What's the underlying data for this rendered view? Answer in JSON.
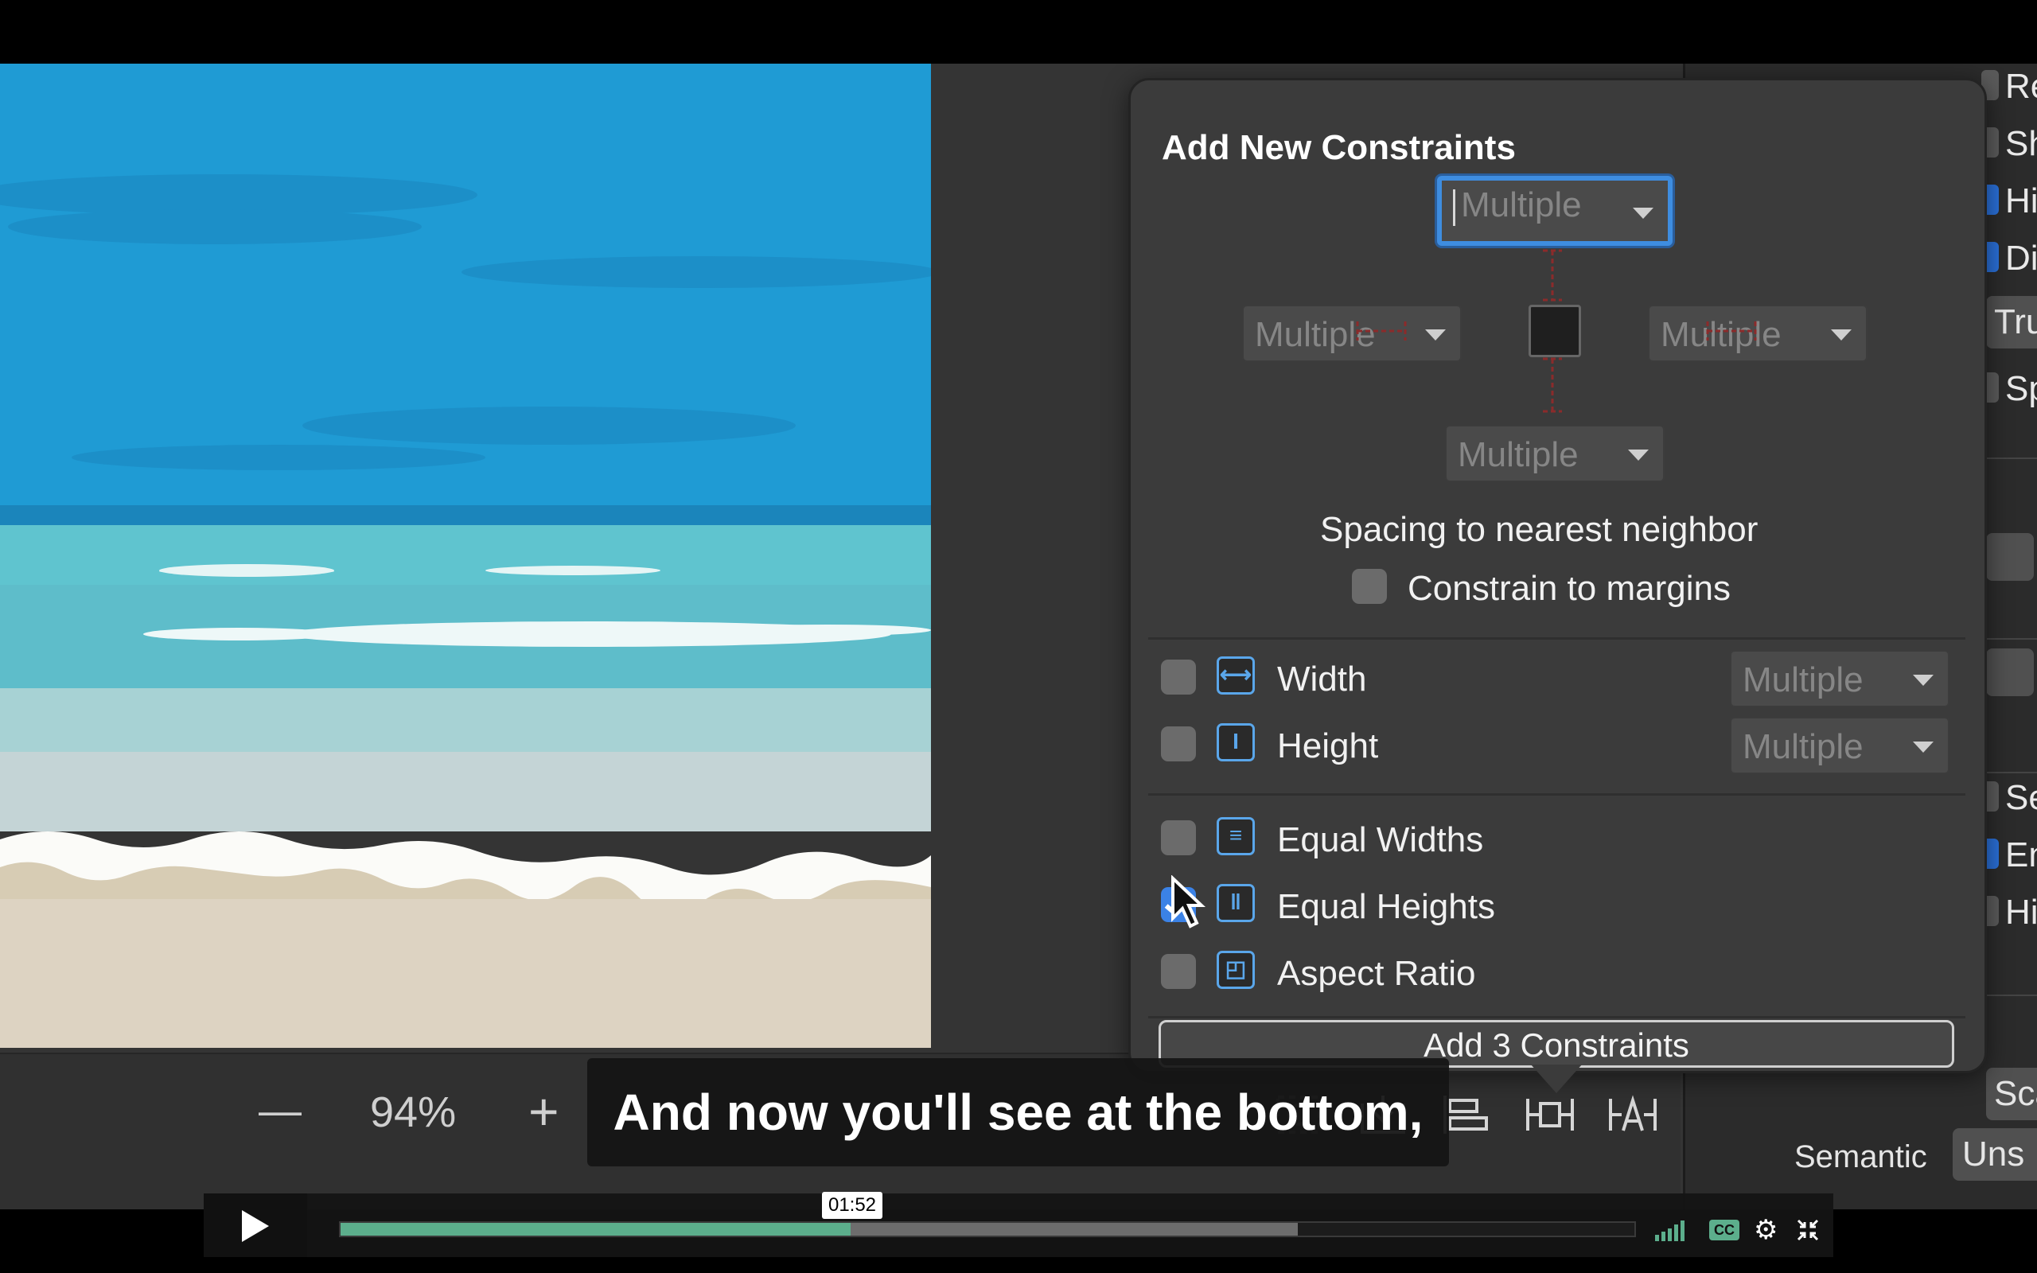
{
  "popover": {
    "title": "Add New Constraints",
    "top_value": "Multiple",
    "left_value": "Multiple",
    "right_value": "Multiple",
    "bottom_value": "Multiple",
    "spacing_label": "Spacing to nearest neighbor",
    "constrain_margins_label": "Constrain to margins",
    "width_label": "Width",
    "width_value": "Multiple",
    "height_label": "Height",
    "height_value": "Multiple",
    "equal_widths_label": "Equal Widths",
    "equal_heights_label": "Equal Heights",
    "aspect_ratio_label": "Aspect Ratio",
    "add_button_label": "Add 3 Constraints",
    "equal_heights_checked": true
  },
  "toolbar": {
    "zoom_minus": "—",
    "zoom_level": "94%",
    "zoom_plus": "+"
  },
  "inspector": {
    "rows": [
      "Re",
      "Sh",
      "Hi",
      "Di",
      "Trun",
      "Sp",
      "Se",
      "En",
      "Hi"
    ],
    "scale_field": "Sca",
    "semantic_label": "Semantic",
    "semantic_value": "Uns"
  },
  "subtitle": "And now you'll see at the bottom,",
  "player": {
    "timestamp": "01:52",
    "played_fraction": 0.394,
    "buffered_fraction": 0.74,
    "cc_label": "CC"
  },
  "colors": {
    "accent": "#3e8de0",
    "progress": "#5cae8c"
  }
}
